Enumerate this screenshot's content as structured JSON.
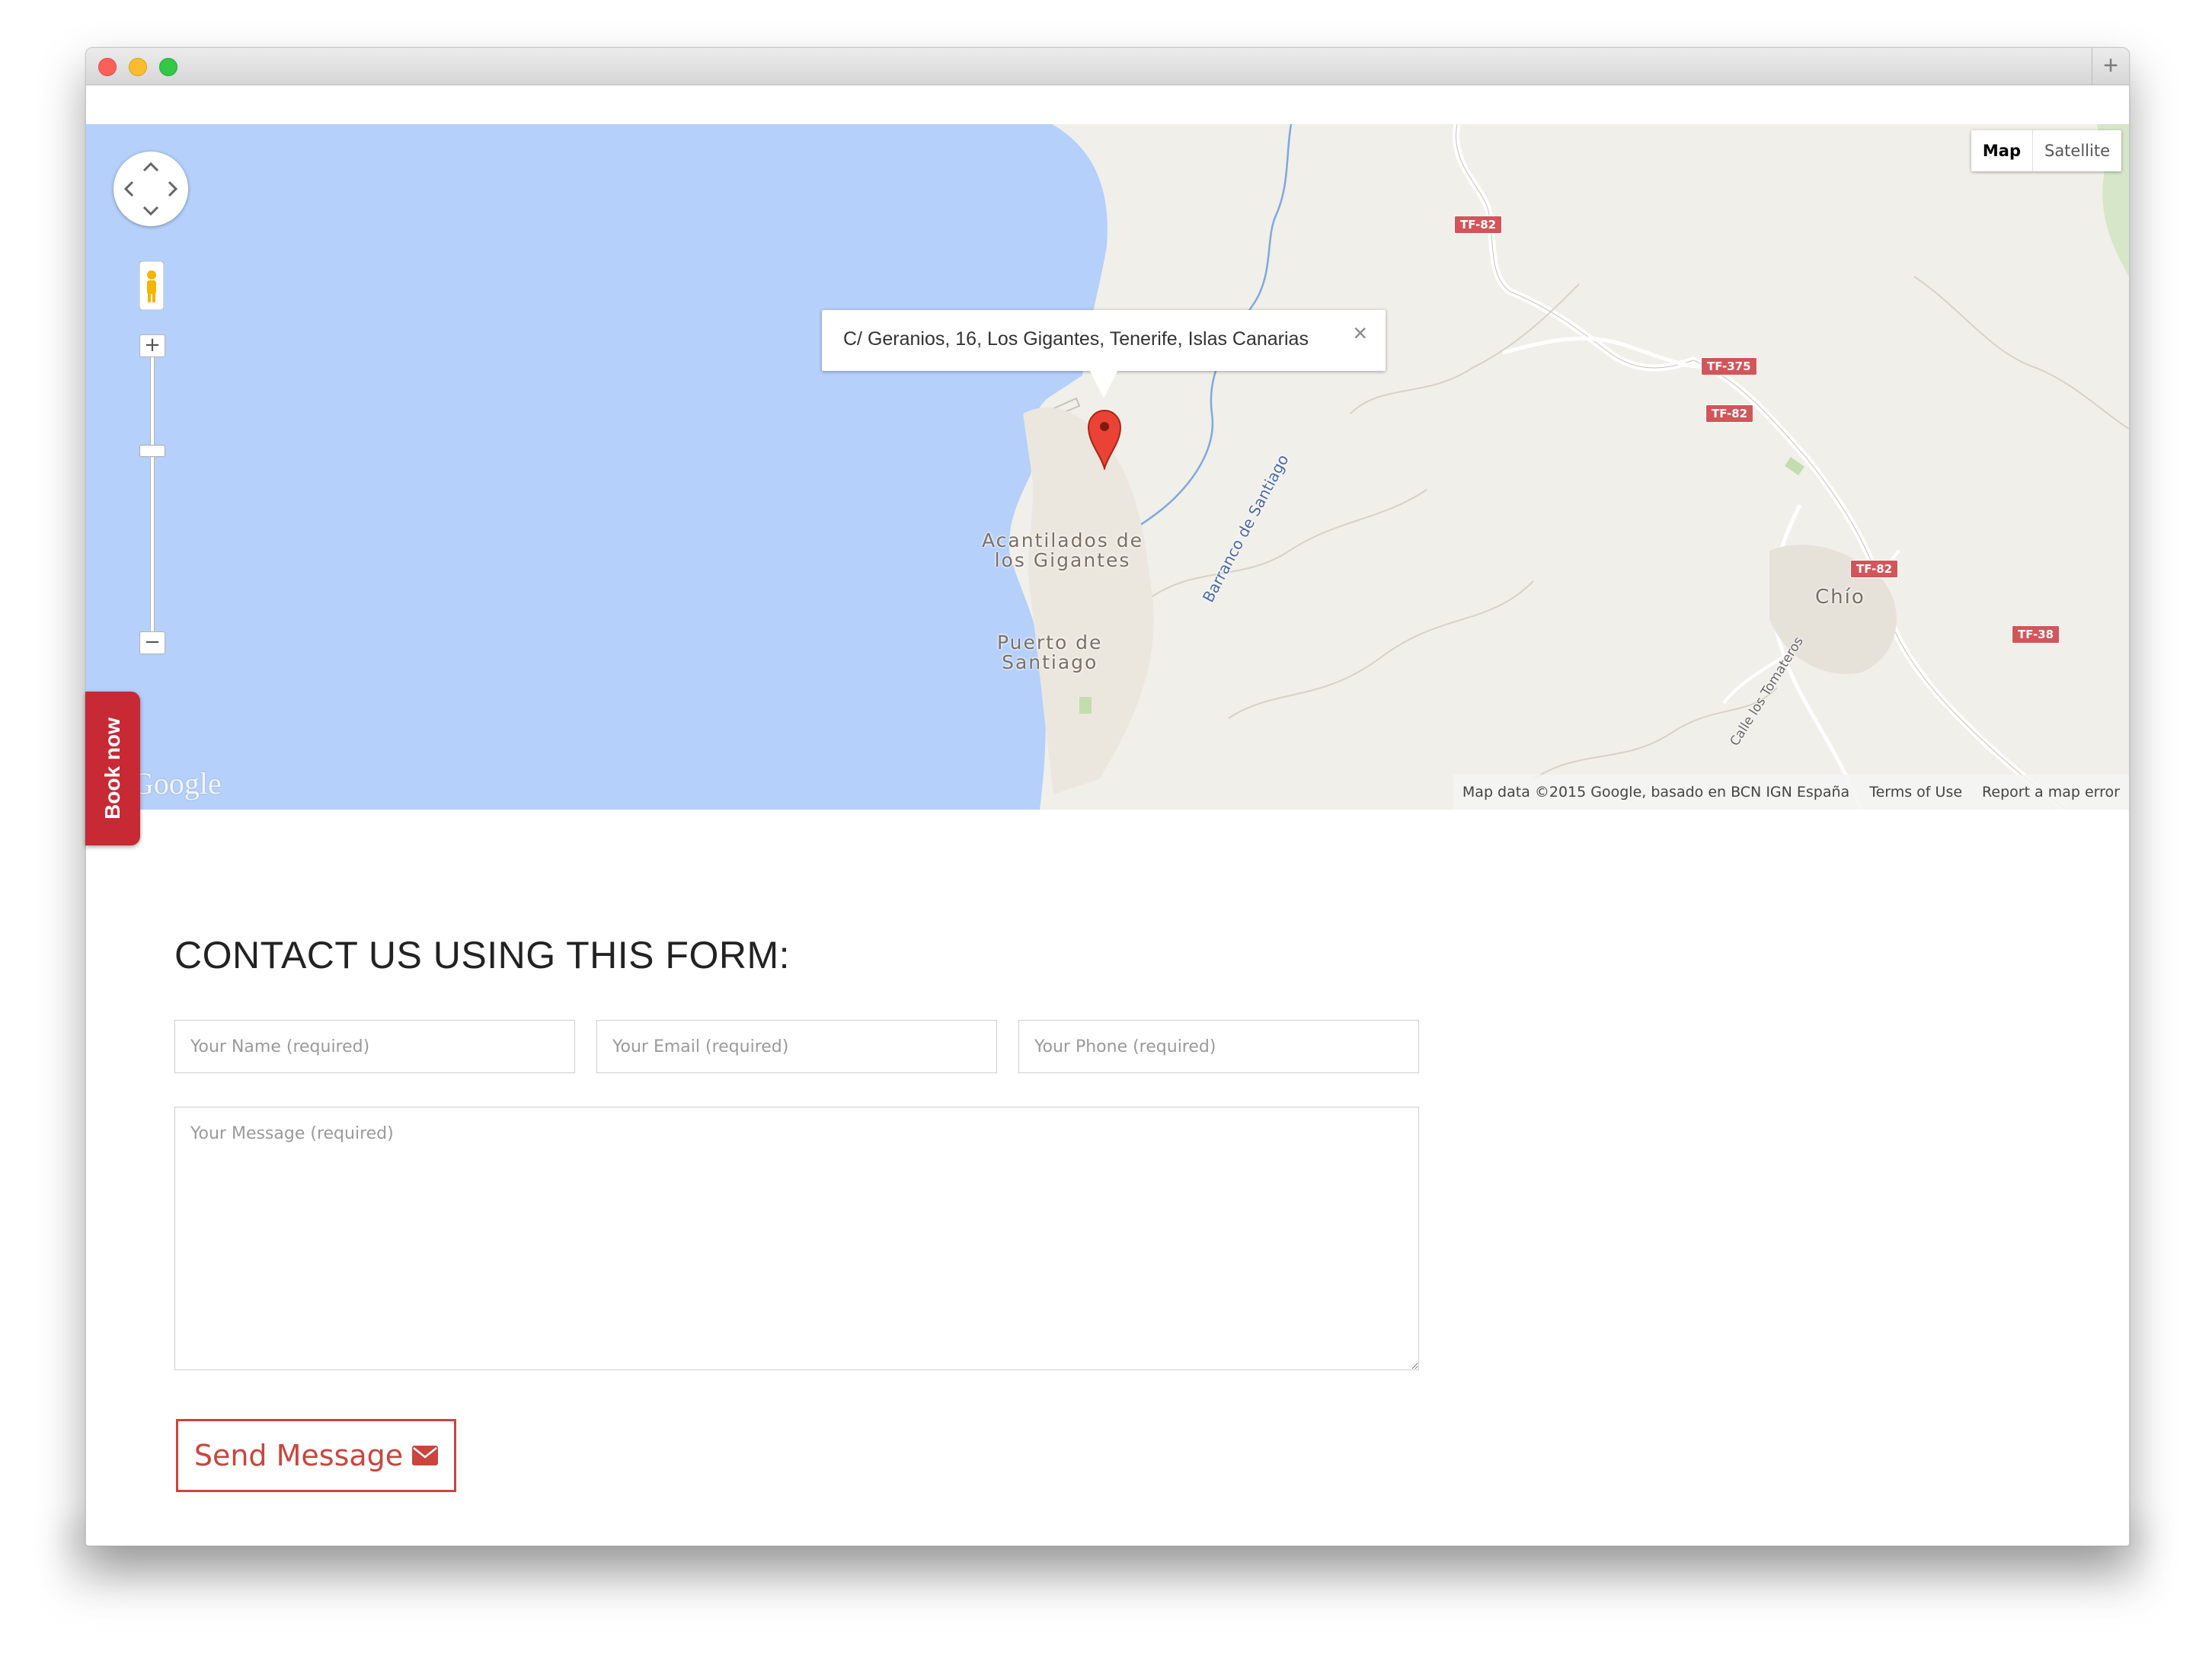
{
  "browser": {
    "new_tab_icon": "plus-icon"
  },
  "map": {
    "map_type_controls": [
      "Map",
      "Satellite"
    ],
    "active_map_type": "Map",
    "info_window": {
      "address": "C/ Geranios, 16, Los Gigantes, Tenerife, Islas Canarias",
      "close_icon": "close-icon"
    },
    "place_labels": {
      "acantilados_line1": "Acantilados de",
      "acantilados_line2": "los Gigantes",
      "puerto_line1": "Puerto de",
      "puerto_line2": "Santiago",
      "chio": "Chío"
    },
    "street_labels": {
      "barranco": "Barranco de Santiago",
      "calle_tomateros": "Calle los Tomateros"
    },
    "road_badges": {
      "tf82_a": "TF-82",
      "tf375": "TF-375",
      "tf82_b": "TF-82",
      "tf82_c": "TF-82",
      "tf38": "TF-38"
    },
    "attribution": {
      "map_data": "Map data ©2015 Google, basado en BCN IGN España",
      "terms": "Terms of Use",
      "report": "Report a map error"
    },
    "logo_text": "Google",
    "zoom_in": "+",
    "zoom_out": "−",
    "colors": {
      "water": "#b4d0fb",
      "land": "#f1efe9",
      "road_badge": "#d2555a",
      "river": "#7fa8e0"
    }
  },
  "book_now": {
    "label": "Book now",
    "color": "#c72935"
  },
  "contact_form": {
    "heading": "CONTACT US USING THIS FORM:",
    "name": {
      "value": "",
      "placeholder": "Your Name (required)"
    },
    "email": {
      "value": "",
      "placeholder": "Your Email (required)"
    },
    "phone": {
      "value": "",
      "placeholder": "Your Phone (required)"
    },
    "message": {
      "value": "",
      "placeholder": "Your Message (required)"
    },
    "send_button_label": "Send Message",
    "send_icon": "envelope-icon",
    "accent_color": "#c9453e"
  }
}
